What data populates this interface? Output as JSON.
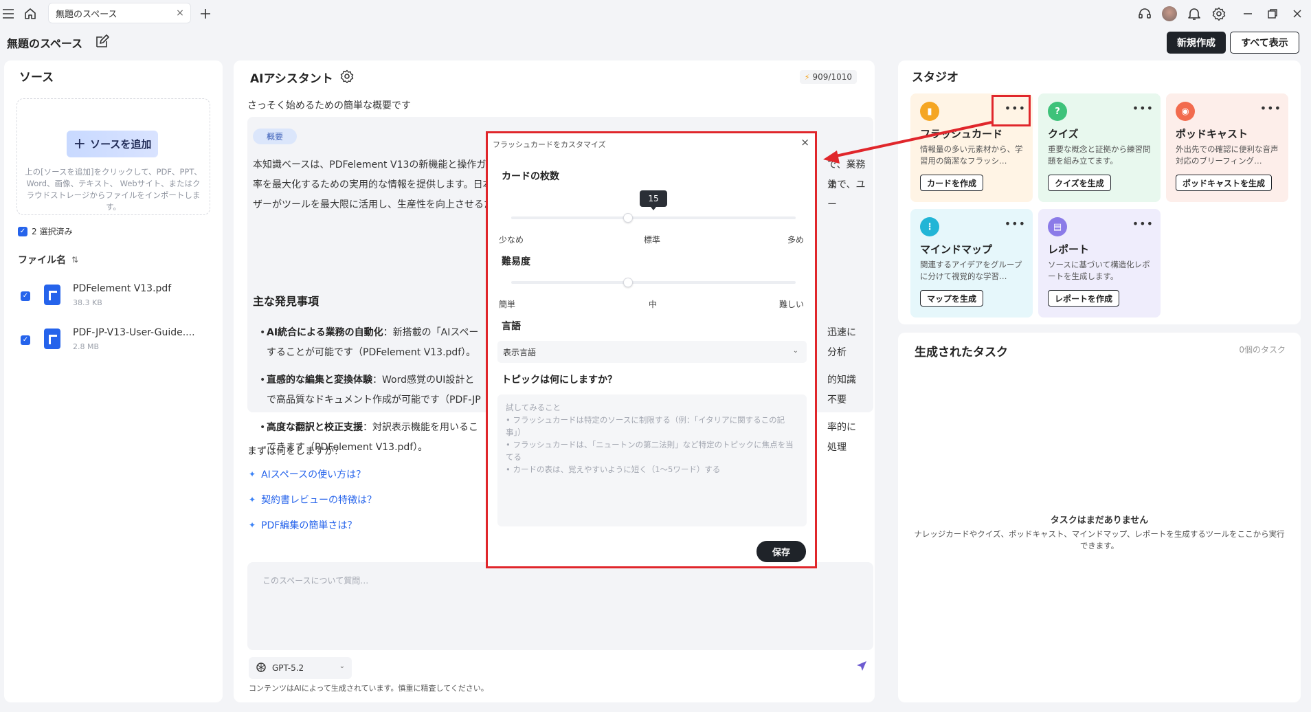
{
  "tab": {
    "title": "無題のスペース"
  },
  "header": {
    "space_title": "無題のスペース",
    "new_button": "新規作成",
    "show_all_button": "すべて表示"
  },
  "source": {
    "title": "ソース",
    "add_button": "ソースを追加",
    "add_hint": "上の[ソースを追加]をクリックして、PDF、PPT、Word、画像、テキスト、 Webサイト、またはクラウドストレージからファイルをインポートします。",
    "selected": "2 選択済み",
    "filename_header": "ファイル名",
    "files": [
      {
        "name": "PDFelement V13.pdf",
        "size": "38.3 KB"
      },
      {
        "name": "PDF-JP-V13-User-Guide....",
        "size": "2.8 MB"
      }
    ]
  },
  "ai": {
    "title": "AIアシスタント",
    "tokens": "909/1010",
    "intro": "さっそく始めるための簡単な概要です",
    "summary_tag": "概要",
    "summary": "本知識ベースは、PDFelement V13の新機能と操作ガ",
    "summary_right_1": "で、業務効",
    "summary_line2": "率を最大化するための実用的な情報を提供します。日本",
    "summary_right_2": "まで、ユー",
    "summary_line3": "ザーがツールを最大限に活用し、生産性を向上させるた",
    "findings_title": "主な発見事項",
    "findings": [
      {
        "bold": "AI統合による業務の自動化",
        "text": "：新搭載の「AIスペー",
        "right": "迅速に分析",
        "line2": "することが可能です（PDFelement V13.pdf）。"
      },
      {
        "bold": "直感的な編集と変換体験",
        "text": "：Word感覚のUI設計と",
        "right": "的知識不要",
        "line2": "で高品質なドキュメント作成が可能です（PDF-JP"
      },
      {
        "bold": "高度な翻訳と校正支援",
        "text": "：対訳表示機能を用いるこ",
        "right": "率的に処理",
        "line2": "できます（PDFelement V13.pdf）。"
      }
    ],
    "next_prompt": "まずは何をしますか？",
    "suggestions": [
      "AIスペースの使い方は？",
      "契約書レビューの特徴は？",
      "PDF編集の簡単さは？"
    ],
    "input_placeholder": "このスペースについて質問…",
    "model": "GPT-5.2",
    "disclaimer": "コンテンツはAIによって生成されています。慎重に精査してください。"
  },
  "studio": {
    "title": "スタジオ",
    "cards": [
      {
        "title": "フラッシュカード",
        "desc": "情報量の多い元素材から、学習用の簡潔なフラッシ…",
        "button": "カードを作成",
        "color": "#f5a623",
        "bg": "#fff4e5"
      },
      {
        "title": "クイズ",
        "desc": "重要な概念と証拠から練習問題を組み立てます。",
        "button": "クイズを生成",
        "color": "#3ec27a",
        "bg": "#e8f8ee"
      },
      {
        "title": "ポッドキャスト",
        "desc": "外出先での確認に便利な音声対応のブリーフィング…",
        "button": "ポッドキャストを生成",
        "color": "#f26b4e",
        "bg": "#fdeeea"
      },
      {
        "title": "マインドマップ",
        "desc": "関連するアイデアをグループに分けて視覚的な学習…",
        "button": "マップを生成",
        "color": "#22b5d6",
        "bg": "#e6f7fb"
      },
      {
        "title": "レポート",
        "desc": "ソースに基づいて構造化レポートを生成します。",
        "button": "レポートを作成",
        "color": "#8b7be8",
        "bg": "#efedfc"
      }
    ]
  },
  "tasks": {
    "title": "生成されたタスク",
    "count": "0個のタスク",
    "empty_title": "タスクはまだありません",
    "empty_desc": "ナレッジカードやクイズ、ポッドキャスト、マインドマップ、レポートを生成するツールをここから実行できます。"
  },
  "modal": {
    "title": "フラッシュカードをカスタマイズ",
    "card_count_label": "カードの枚数",
    "card_count_value": "15",
    "card_count_fraction": 0.41,
    "count_min": "少なめ",
    "count_mid": "標準",
    "count_max": "多め",
    "difficulty_label": "難易度",
    "difficulty_fraction": 0.41,
    "diff_min": "簡単",
    "diff_mid": "中",
    "diff_max": "難しい",
    "language_label": "言語",
    "language_value": "表示言語",
    "topic_label": "トピックは何にしますか？",
    "topic_placeholder": "試してみること\n• フラッシュカードは特定のソースに制限する（例：「イタリアに関するこの記事」）\n• フラッシュカードは、「ニュートンの第二法則」など特定のトピックに焦点を当てる\n• カードの表は、覚えやすいように短く（1〜5ワード）する",
    "save_button": "保存"
  }
}
